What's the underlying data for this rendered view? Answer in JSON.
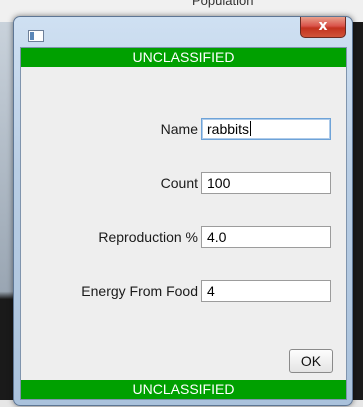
{
  "backdrop": {
    "parent_text": "Population"
  },
  "window": {
    "close_label": "x"
  },
  "banner": {
    "top": "UNCLASSIFIED",
    "bottom": "UNCLASSIFIED"
  },
  "fields": [
    {
      "label": "Name",
      "value": "rabbits"
    },
    {
      "label": "Count",
      "value": "100"
    },
    {
      "label": "Reproduction %",
      "value": "4.0"
    },
    {
      "label": "Energy From Food",
      "value": "4"
    }
  ],
  "buttons": {
    "ok": "OK"
  },
  "colors": {
    "banner": "#00a000",
    "close_button": "#c2321f"
  }
}
